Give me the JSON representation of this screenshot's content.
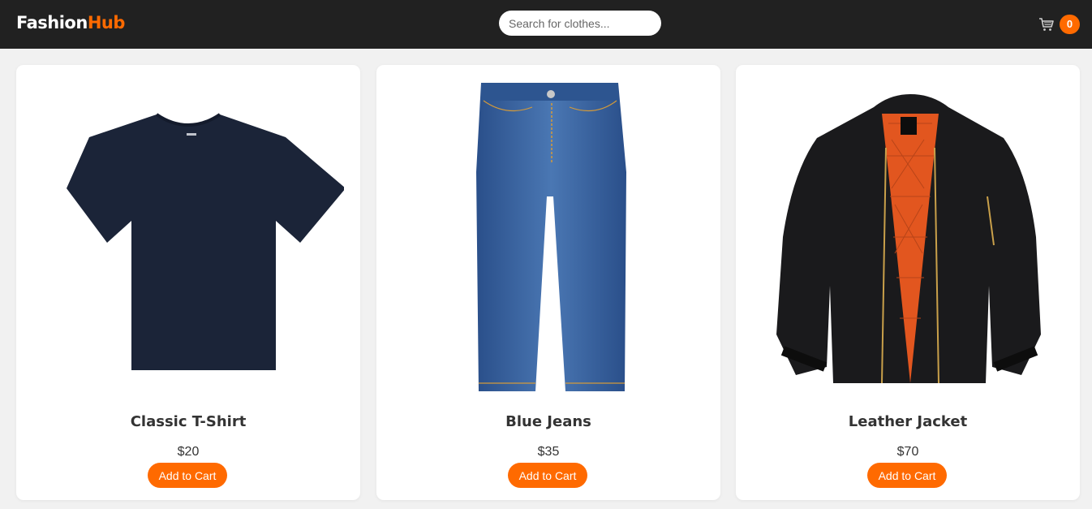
{
  "header": {
    "logo_part1": "Fashion",
    "logo_part2": "Hub",
    "search_placeholder": "Search for clothes...",
    "cart_icon": "cart-icon",
    "cart_count": "0",
    "accent_color": "#ff6a00",
    "nav_bg": "#212121"
  },
  "products": [
    {
      "name": "Classic T-Shirt",
      "price": "$20",
      "button": "Add to Cart",
      "image": "navy-tshirt"
    },
    {
      "name": "Blue Jeans",
      "price": "$35",
      "button": "Add to Cart",
      "image": "blue-jeans"
    },
    {
      "name": "Leather Jacket",
      "price": "$70",
      "button": "Add to Cart",
      "image": "black-jacket"
    }
  ]
}
